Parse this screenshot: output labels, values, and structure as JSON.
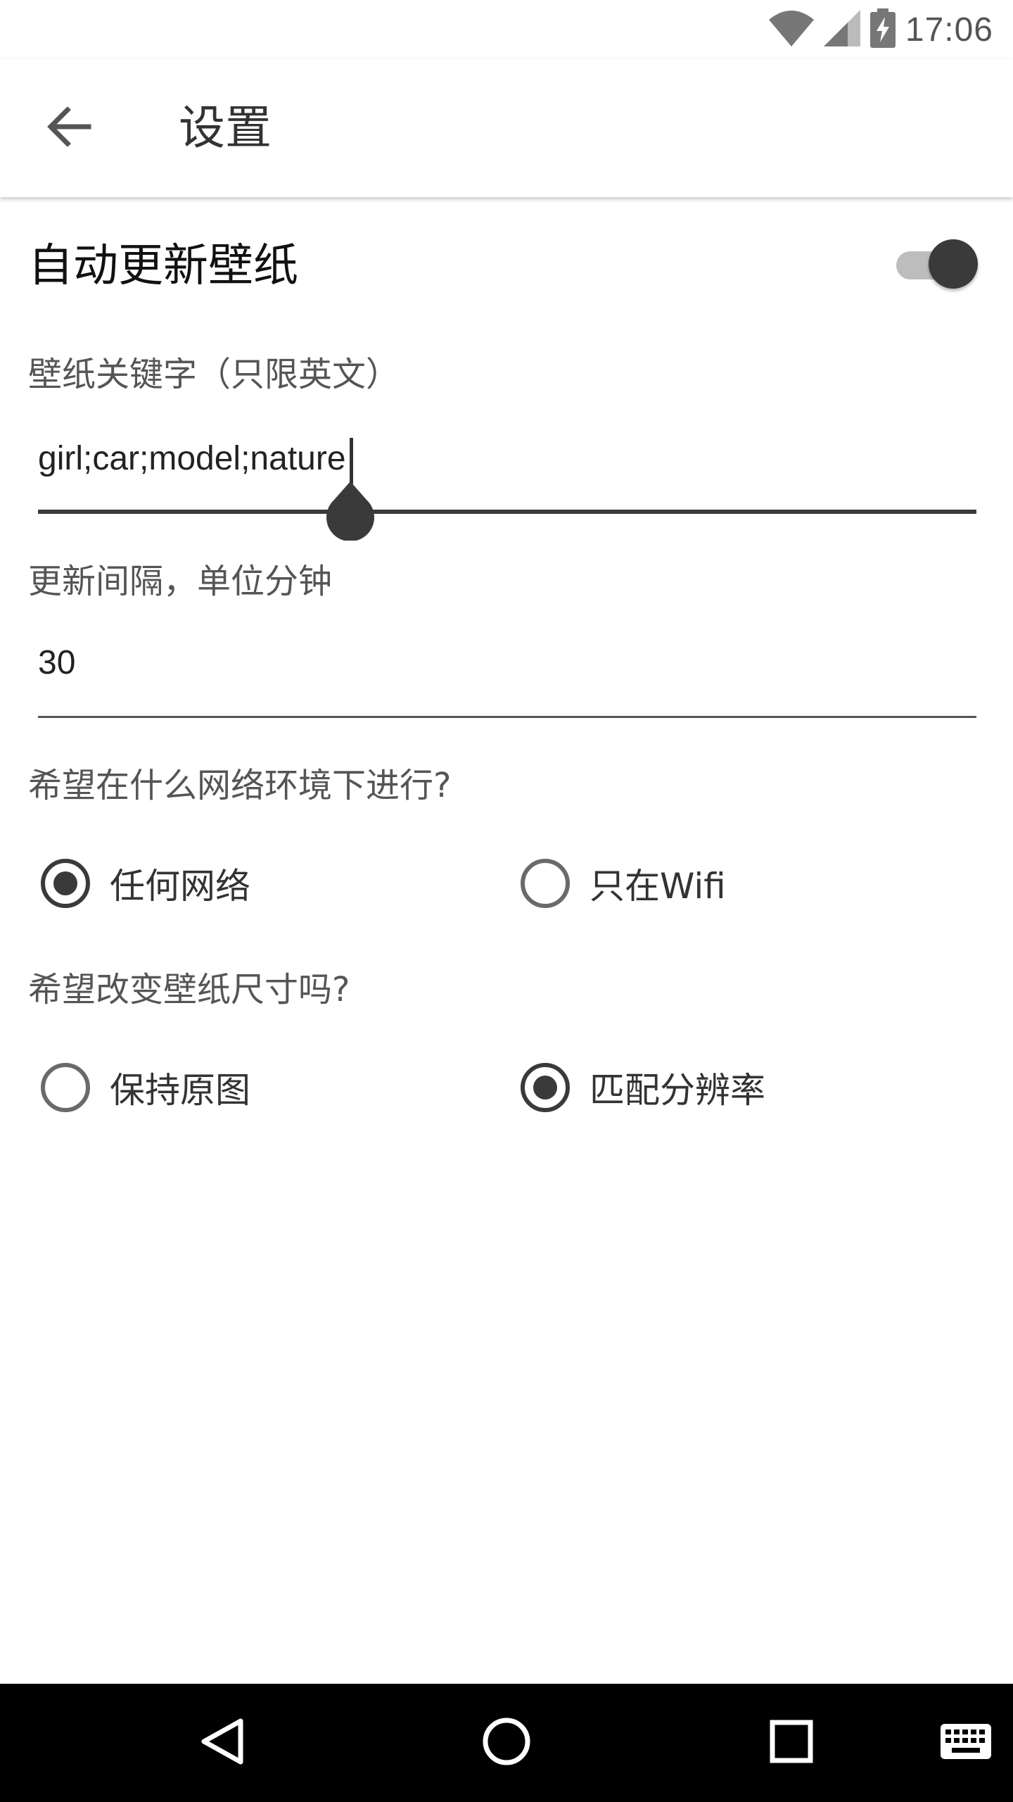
{
  "status_bar": {
    "time": "17:06",
    "icons": [
      "wifi-icon",
      "cellular-signal-icon",
      "battery-charging-icon"
    ]
  },
  "app_bar": {
    "title": "设置",
    "back_icon": "arrow-back-icon"
  },
  "auto_update": {
    "label": "自动更新壁纸",
    "enabled": true
  },
  "keywords": {
    "label": "壁纸关键字（只限英文）",
    "value": "girl;car;model;nature"
  },
  "interval": {
    "label": "更新间隔，单位分钟",
    "value": "30"
  },
  "network": {
    "question": "希望在什么网络环境下进行?",
    "options": [
      {
        "label": "任何网络",
        "checked": true
      },
      {
        "label": "只在Wifi",
        "checked": false
      }
    ]
  },
  "size": {
    "question": "希望改变壁纸尺寸吗?",
    "options": [
      {
        "label": "保持原图",
        "checked": false
      },
      {
        "label": "匹配分辨率",
        "checked": true
      }
    ]
  },
  "nav_bar": {
    "icons": [
      "back-triangle-icon",
      "home-circle-icon",
      "recents-square-icon",
      "keyboard-icon"
    ]
  },
  "colors": {
    "accent": "#3a3a3a",
    "nav_background": "#000000"
  }
}
